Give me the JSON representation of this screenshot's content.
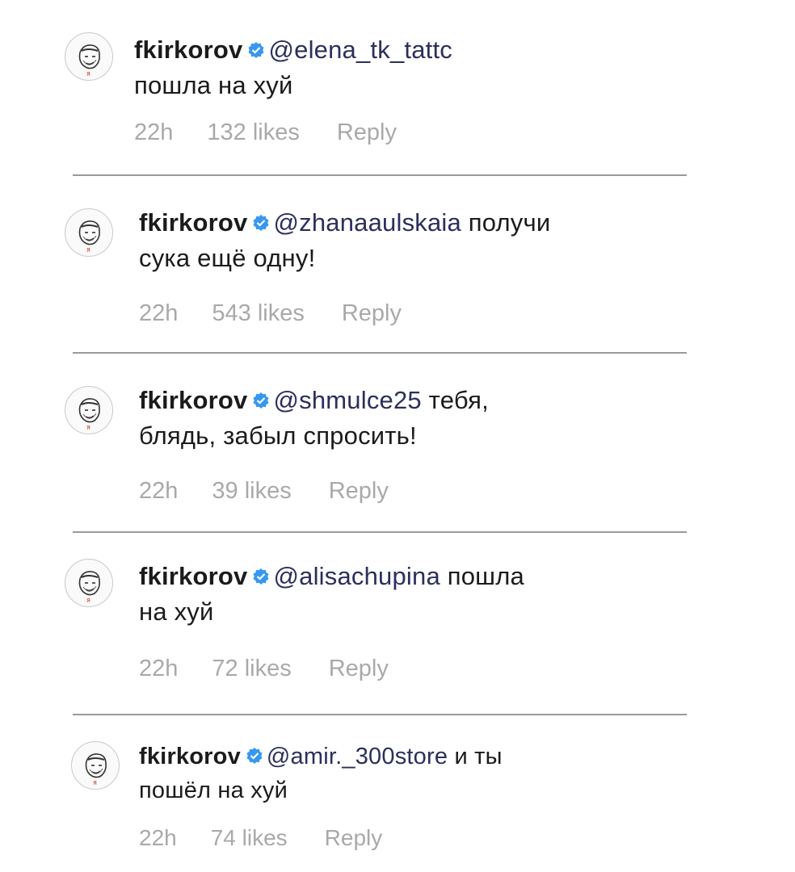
{
  "comments": [
    {
      "username": "fkirkorov",
      "mention": "@elena_tk_tattc",
      "text_line1": "",
      "text_line2": "пошла на хуй",
      "time": "22h",
      "likes": "132 likes",
      "reply": "Reply"
    },
    {
      "username": "fkirkorov",
      "mention": "@zhanaaulskaia",
      "text_line1": " получи",
      "text_line2": "сука ещё одну!",
      "time": "22h",
      "likes": "543 likes",
      "reply": "Reply"
    },
    {
      "username": "fkirkorov",
      "mention": "@shmulce25",
      "text_line1": " тебя,",
      "text_line2": "блядь, забыл спросить!",
      "time": "22h",
      "likes": "39 likes",
      "reply": "Reply"
    },
    {
      "username": "fkirkorov",
      "mention": "@alisachupina",
      "text_line1": " пошла",
      "text_line2": "на хуй",
      "time": "22h",
      "likes": "72 likes",
      "reply": "Reply"
    },
    {
      "username": "fkirkorov",
      "mention": "@amir._300store",
      "text_line1": " и ты",
      "text_line2": "пошёл на хуй",
      "time": "22h",
      "likes": "74 likes",
      "reply": "Reply"
    }
  ],
  "colors": {
    "verified_badge": "#3897f0",
    "meta_text": "#a9a9a9",
    "divider": "#9a9a9a"
  },
  "icons": {
    "avatar": "sketch-portrait-avatar",
    "badge": "verified-badge-icon"
  }
}
